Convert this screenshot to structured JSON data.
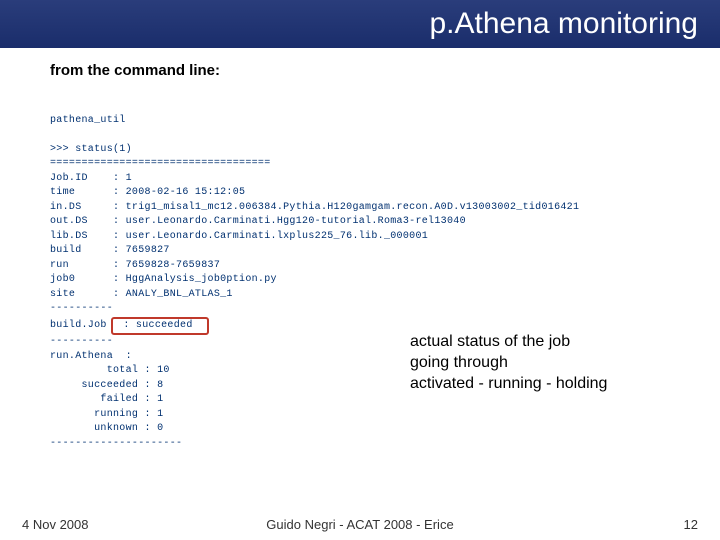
{
  "title": "p.Athena monitoring",
  "subtitle": "from the command line:",
  "cmd": "pathena_util",
  "prompt": ">>> status(1)",
  "sep": "===================================",
  "fields": {
    "jobid": "Job.ID    : 1",
    "time": "time      : 2008-02-16 15:12:05",
    "inds": "in.DS     : trig1_misal1_mc12.006384.Pythia.H120gamgam.recon.A0D.v13003002_tid016421",
    "outds": "out.DS    : user.Leonardo.Carminati.Hgg120-tutorial.Roma3-rel13040",
    "libds": "lib.DS    : user.Leonardo.Carminati.lxplus225_76.lib._000001",
    "build": "build     : 7659827",
    "run": "run       : 7659828-7659837",
    "job0": "job0      : HggAnalysis_job0ption.py",
    "site": "site      : ANALY_BNL_ATLAS_1"
  },
  "dash1": "----------",
  "buildjob_label": "build.Job ",
  "buildjob_value": " : succeeded ",
  "dash2": "----------",
  "runathena": "run.Athena  :",
  "counts": {
    "total": "         total : 10",
    "succeeded": "     succeeded : 8",
    "failed": "        failed : 1",
    "running": "       running : 1",
    "unknown": "       unknown : 0"
  },
  "dash3": "---------------------",
  "annotation_l1": "actual status of the job",
  "annotation_l2": "going through",
  "annotation_l3": "activated - running - holding",
  "footer": {
    "date": "4 Nov 2008",
    "center": "Guido Negri - ACAT 2008 - Erice",
    "page": "12"
  }
}
